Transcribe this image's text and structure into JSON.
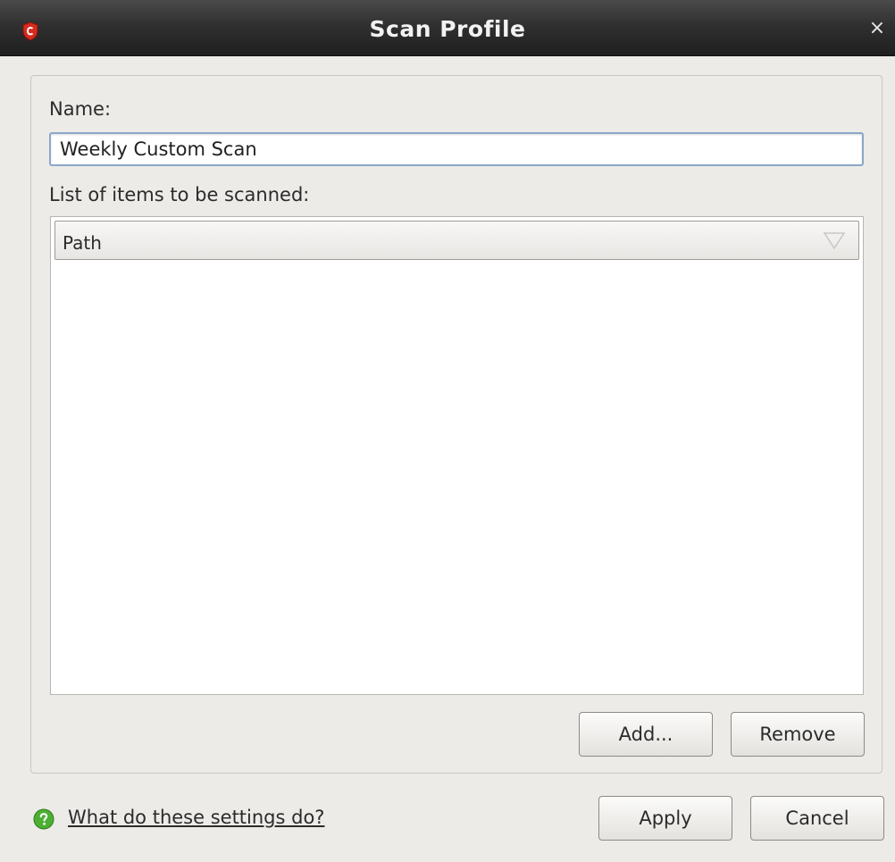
{
  "window": {
    "title": "Scan Profile",
    "close_glyph": "×"
  },
  "form": {
    "name_label": "Name:",
    "name_value": "Weekly Custom Scan",
    "items_label": "List of items to be scanned:",
    "list": {
      "columns": [
        "Path"
      ],
      "rows": []
    },
    "add_label": "Add...",
    "remove_label": "Remove"
  },
  "footer": {
    "help_link": "What do these settings do?",
    "apply_label": "Apply",
    "cancel_label": "Cancel"
  },
  "icons": {
    "app": "comodo-shield-icon",
    "close": "close-icon",
    "sort": "sort-arrow-icon",
    "help": "help-icon"
  },
  "colors": {
    "titlebar": "#2e2e2e",
    "window_bg": "#edebe8",
    "input_border": "#8aa8c8",
    "brand_red": "#d52b1e",
    "help_green": "#4caf32"
  }
}
